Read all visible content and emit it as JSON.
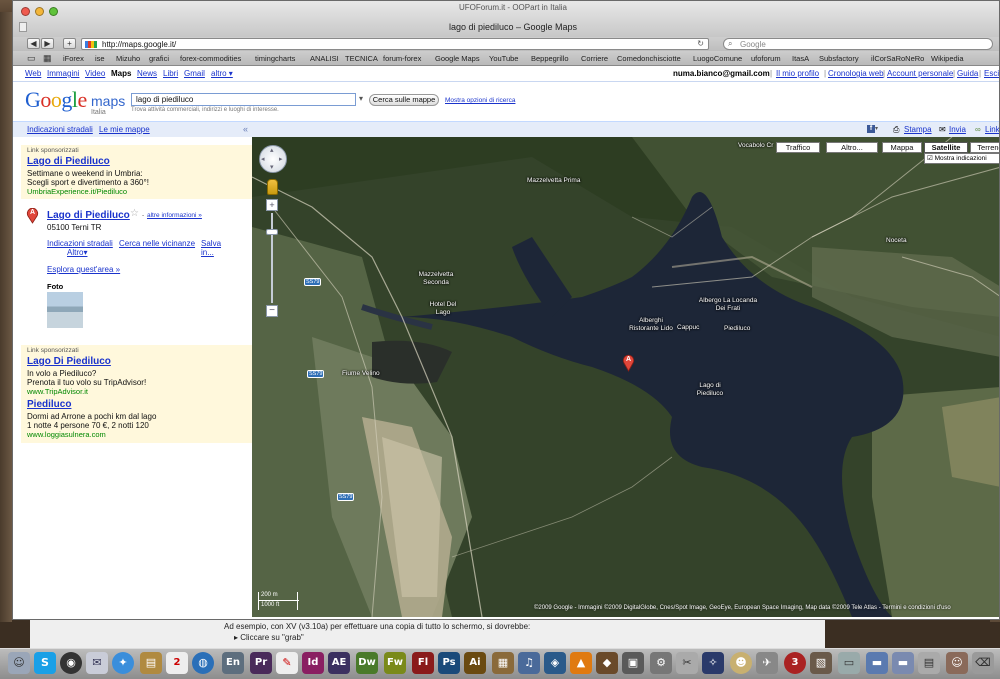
{
  "window": {
    "subtitle": "UFOForum.it - OOPart in Italia",
    "title": "lago di piediluco – Google Maps"
  },
  "browser": {
    "url": "http://maps.google.it/",
    "search_placeholder": "Google",
    "bookmarks": [
      "iForex",
      "ise",
      "Mizuho",
      "grafici",
      "forex-commodities",
      "timingcharts",
      "ANALISI",
      "TECNICA",
      "forum-forex",
      "Google Maps",
      "YouTube",
      "Beppegrillo",
      "Corriere",
      "Comedonchisciotte",
      "LuogoComune",
      "ufoforum",
      "ItasA",
      "Subsfactory",
      "ilCorSaRoNeRo",
      "Wikipedia"
    ]
  },
  "gbar": {
    "links": [
      "Web",
      "Immagini",
      "Video",
      "Maps",
      "News",
      "Libri",
      "Gmail",
      "altro ▾"
    ],
    "email": "numa.bianco@gmail.com",
    "right_links": [
      "Il mio profilo",
      "Cronologia web",
      "Account personale",
      "Guida",
      "Esci"
    ]
  },
  "search": {
    "logo_google": "Google",
    "logo_maps": "maps",
    "logo_country": "Italia",
    "query": "lago di piediluco",
    "button": "Cerca sulle mappe",
    "more_options": "Mostra opzioni di ricerca",
    "hint": "Trova attività commerciali, indirizzi e luoghi di interesse."
  },
  "pagebar": {
    "directions": "Indicazioni stradali",
    "my_maps": "Le mie mappe",
    "collapse": "«",
    "print": "Stampa",
    "send": "Invia",
    "link": "Link"
  },
  "sidebar": {
    "sponsored_label": "Link sponsorizzati",
    "ad1": {
      "title": "Lago di Piediluco",
      "line1": "Settimane o weekend in Umbria:",
      "line2": "Scegli sport e divertimento a 360°!",
      "url": "UmbriaExperience.it/Piediluco"
    },
    "result": {
      "marker": "A",
      "name": "Lago di Piediluco",
      "star": "☆",
      "more_info": "altre informazioni »",
      "address": "05100 Terni TR",
      "actions": [
        "Indicazioni stradali",
        "Cerca nelle vicinanze",
        "Salva in...",
        "Altro▾"
      ],
      "explore": "Esplora quest'area »",
      "photos_label": "Foto"
    },
    "sponsored_label2": "Link sponsorizzati",
    "ad2": {
      "title": "Lago Di Piediluco",
      "line1": "In volo a Piediluco?",
      "line2": "Prenota il tuo volo su TripAdvisor!",
      "url": "www.TripAdvisor.it"
    },
    "ad3": {
      "title": "Piediluco",
      "line1": "Dormi ad Arrone a pochi km dal lago",
      "line2": "1 notte 4 persone 70 €, 2 notti 120",
      "url": "www.loggiasulnera.com"
    }
  },
  "map": {
    "buttons": [
      "Traffico",
      "Altro...",
      "Mappa",
      "Satellite",
      "Terreno"
    ],
    "active_button": "Satellite",
    "show_labels": "Mostra indicazioni",
    "marker": "A",
    "labels": [
      "Mazzelvetta Prima",
      "Mazzelvetta Seconda",
      "Hotel Del Lago",
      "Alberghi Ristorante Lido",
      "Albergo La Locanda Dei Frati",
      "Cappuc",
      "Piediluco",
      "Lago di Piediluco",
      "Noceta",
      "Fiume Velino",
      "Vocabolo Cr"
    ],
    "road_shields": [
      "SS79",
      "SS79",
      "SS79"
    ],
    "scale": [
      "200 m",
      "1000 ft"
    ],
    "copyright": "©2009 Google - Immagini ©2009 DigitalGlobe, Cnes/Spot Image, GeoEye, European Space Imaging, Map data ©2009 Tele Atlas - Termini e condizioni d'uso"
  },
  "behind_document": {
    "line1": "Ad esempio, con XV (v3.10a) per effettuare una copia di tutto lo schermo, si dovrebbe:",
    "line2": "Cliccare su \"grab\""
  },
  "dock": {
    "labels": [
      "En",
      "Pr",
      "Id",
      "AE",
      "Dw",
      "Fw",
      "Fl",
      "Ps",
      "Ai"
    ]
  }
}
